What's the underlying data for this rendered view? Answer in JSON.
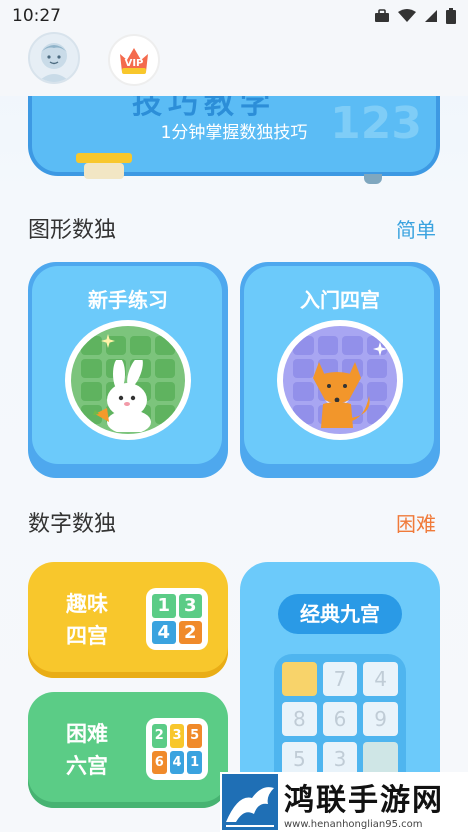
{
  "status_bar": {
    "time": "10:27"
  },
  "banner": {
    "title": "技巧教学",
    "subtitle": "1分钟掌握数独技巧",
    "deco_numbers": "123"
  },
  "sections": {
    "graphic": {
      "title": "图形数独",
      "level": "简单",
      "level_color": "#3aa3df"
    },
    "number": {
      "title": "数字数独",
      "level": "困难",
      "level_color": "#f07a3a"
    }
  },
  "graphic_cards": [
    {
      "title": "新手练习",
      "animal": "rabbit-icon"
    },
    {
      "title": "入门四宫",
      "animal": "fox-icon"
    }
  ],
  "number_cards": {
    "fun4": {
      "line1": "趣味",
      "line2": "四宫",
      "digits": [
        "1",
        "3",
        "4",
        "2"
      ]
    },
    "hard6": {
      "line1": "困难",
      "line2": "六宫",
      "digits": [
        "2",
        "3",
        "5",
        "6",
        "4",
        "1"
      ]
    },
    "classic9": {
      "title": "经典九宫",
      "keys": [
        "",
        "7",
        "4",
        "8",
        "6",
        "9",
        "5",
        "3",
        ""
      ]
    }
  },
  "watermark": {
    "title": "鸿联手游网",
    "url": "www.henanhonglian95.com"
  },
  "header": {
    "vip_label": "VIP"
  }
}
